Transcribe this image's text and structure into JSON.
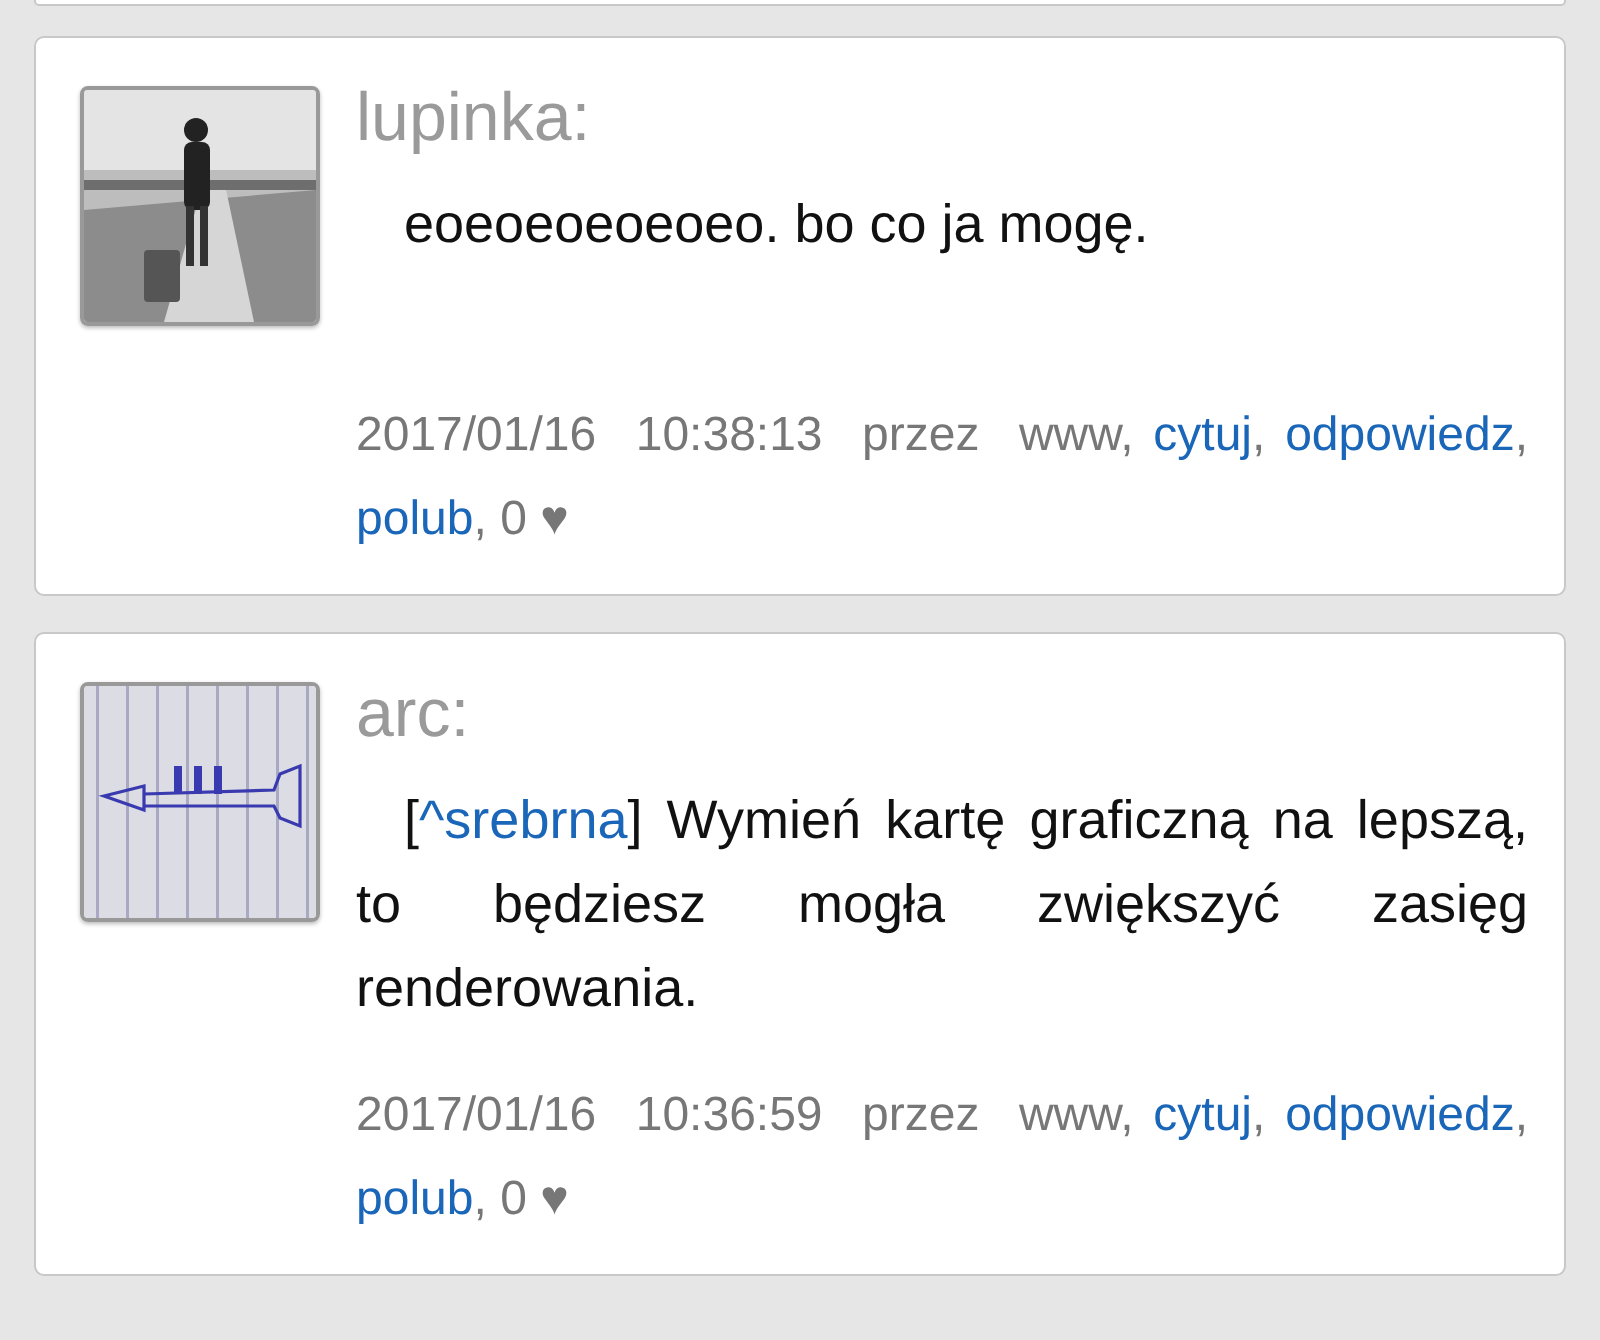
{
  "posts": [
    {
      "author": "lupinka:",
      "avatar": {
        "kind": "picture"
      },
      "message": [
        {
          "kind": "text",
          "text": "eoeoeoeoeoeo. bo co ja mogę."
        }
      ],
      "meta": [
        {
          "kind": "text",
          "text": "2017/01/16  10:38:13  przez  www, "
        },
        {
          "kind": "link",
          "text": "cytuj"
        },
        {
          "kind": "text",
          "text": ", "
        },
        {
          "kind": "link",
          "text": "odpowiedz"
        },
        {
          "kind": "text",
          "text": ", "
        },
        {
          "kind": "link",
          "text": "polub"
        },
        {
          "kind": "text",
          "text": ", 0 ♥"
        }
      ]
    },
    {
      "author": "arc:",
      "avatar": {
        "kind": "picture"
      },
      "message": [
        {
          "kind": "text",
          "text": "["
        },
        {
          "kind": "link",
          "text": "^srebrna"
        },
        {
          "kind": "text",
          "text": "] Wymień kartę graficzną na lepszą, to będziesz mogła zwiększyć zasięg renderowania."
        }
      ],
      "meta": [
        {
          "kind": "text",
          "text": "2017/01/16  10:36:59  przez  www, "
        },
        {
          "kind": "link",
          "text": "cytuj"
        },
        {
          "kind": "text",
          "text": ", "
        },
        {
          "kind": "link",
          "text": "odpowiedz"
        },
        {
          "kind": "text",
          "text": ", "
        },
        {
          "kind": "link",
          "text": "polub"
        },
        {
          "kind": "text",
          "text": ", 0 ♥"
        }
      ]
    }
  ]
}
